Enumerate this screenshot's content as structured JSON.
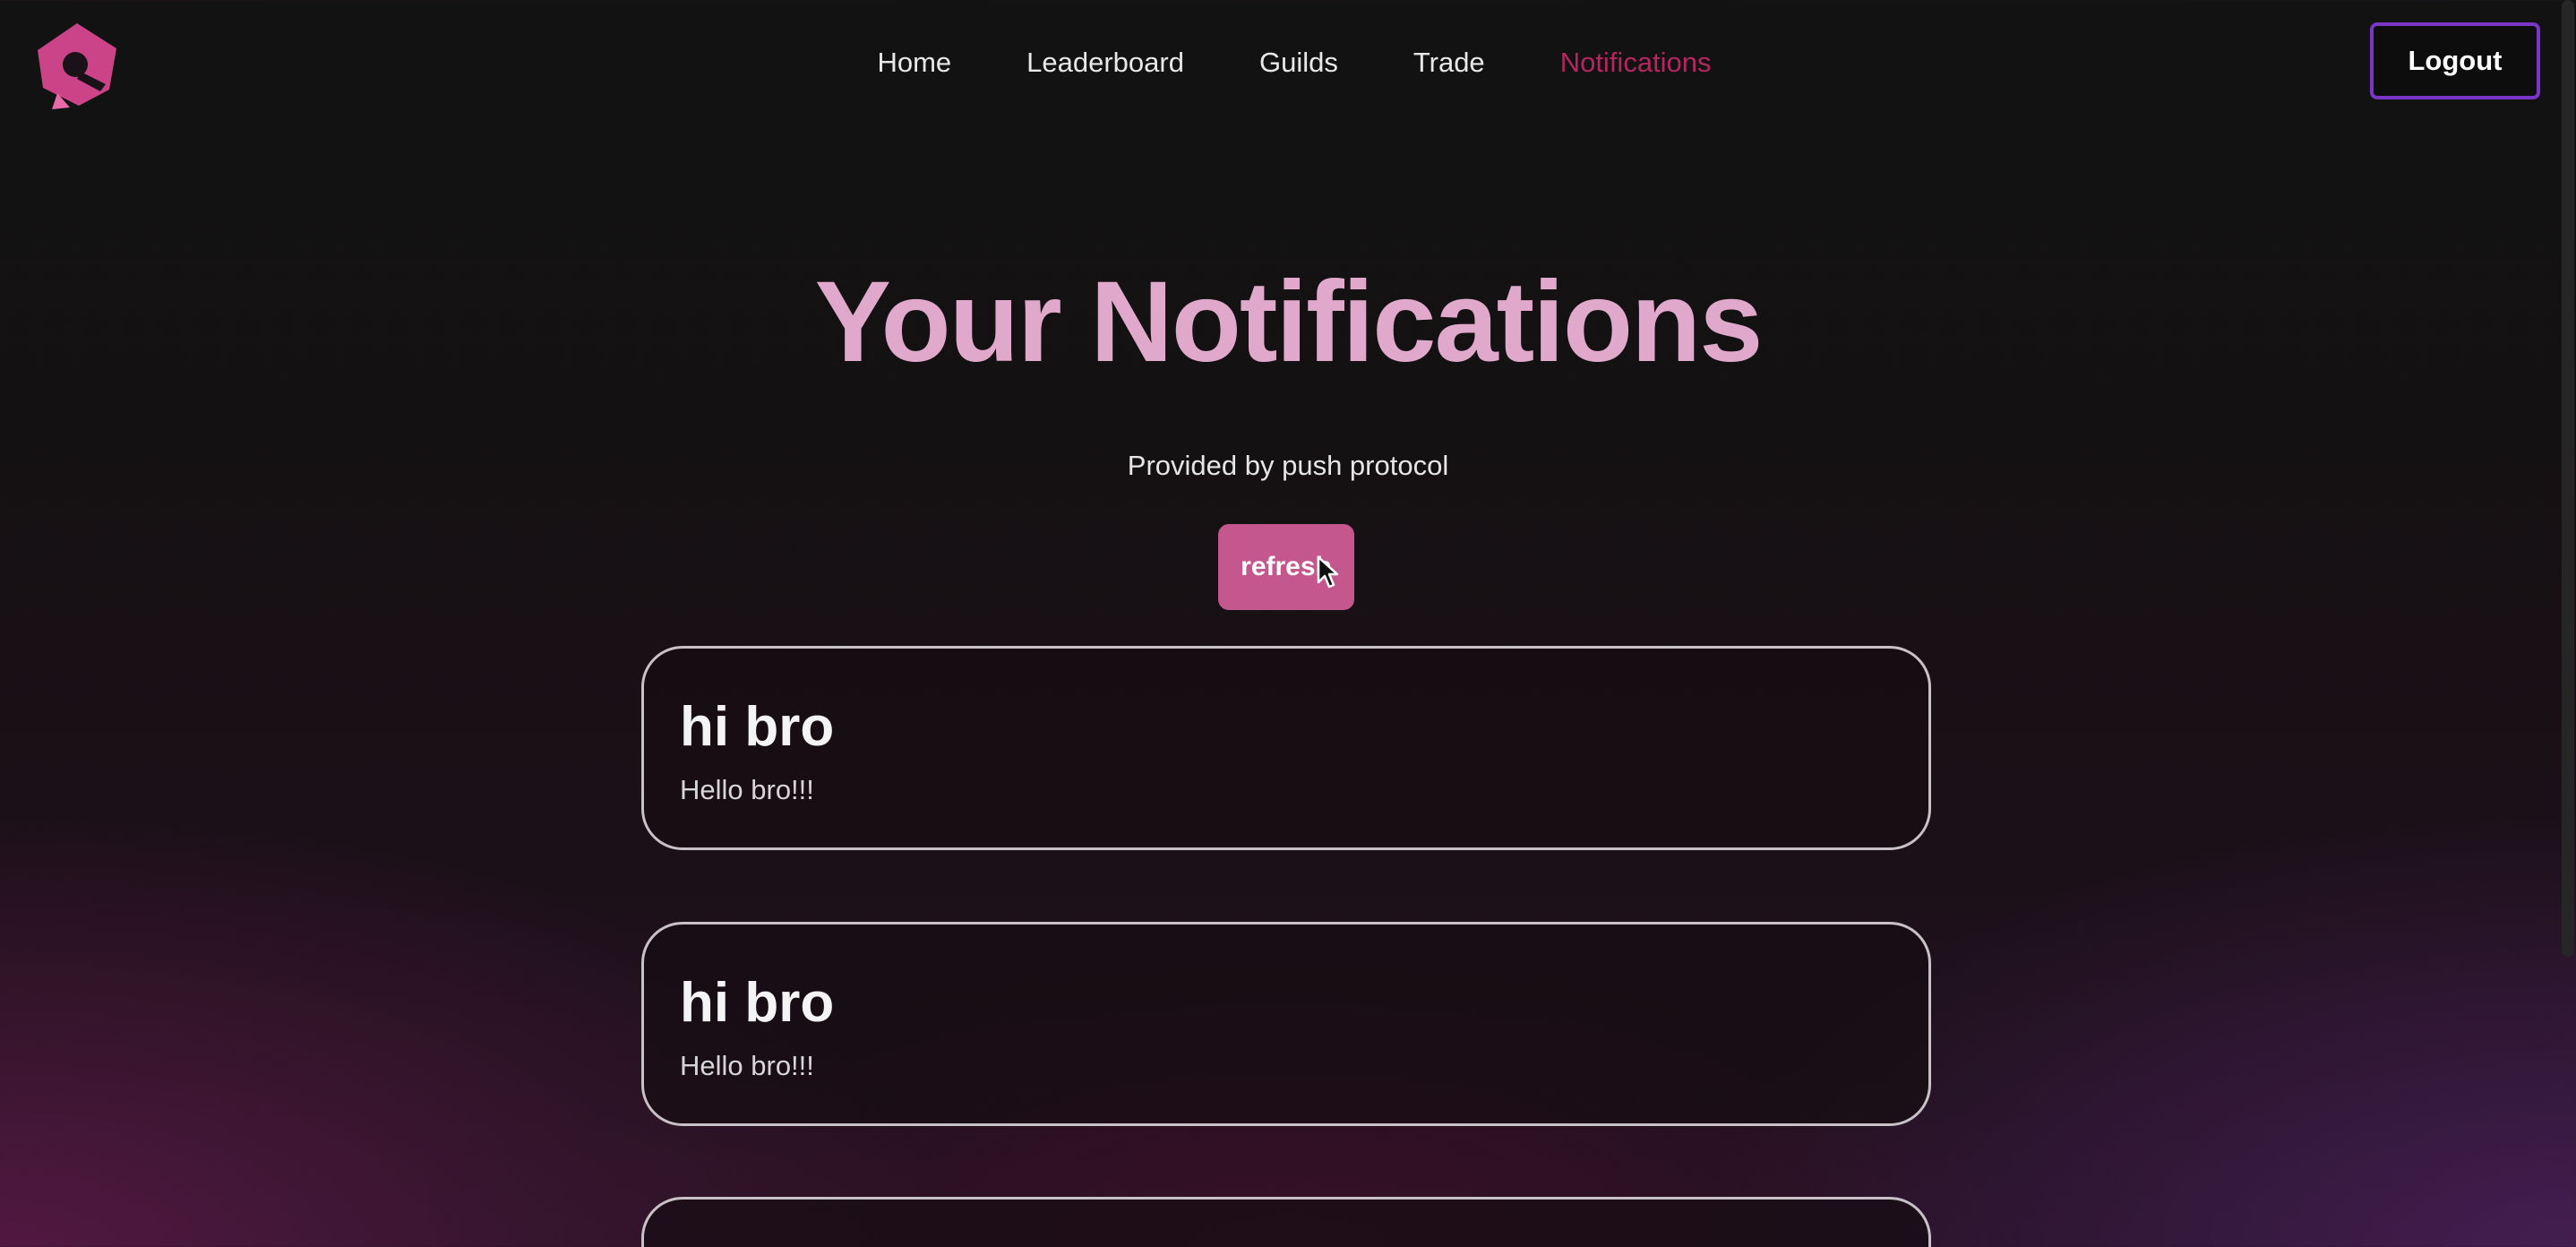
{
  "header": {
    "nav": [
      {
        "label": "Home"
      },
      {
        "label": "Leaderboard"
      },
      {
        "label": "Guilds"
      },
      {
        "label": "Trade"
      },
      {
        "label": "Notifications"
      }
    ],
    "active_nav": "Notifications",
    "logout_label": "Logout"
  },
  "main": {
    "title": "Your Notifications",
    "subtitle": "Provided by push protocol",
    "refresh_label": "refresh",
    "notifications": [
      {
        "title": "hi bro",
        "body": "Hello bro!!!"
      },
      {
        "title": "hi bro",
        "body": "Hello bro!!!"
      }
    ]
  },
  "colors": {
    "accent_pink": "#c5578f",
    "title_pink": "#e0a9cb",
    "active_nav": "#b3265f",
    "logout_border": "#7a36c9",
    "logo": "#d6478f"
  },
  "icons": {
    "logo": "brand-logo-icon",
    "cursor": "mouse-pointer-icon"
  }
}
